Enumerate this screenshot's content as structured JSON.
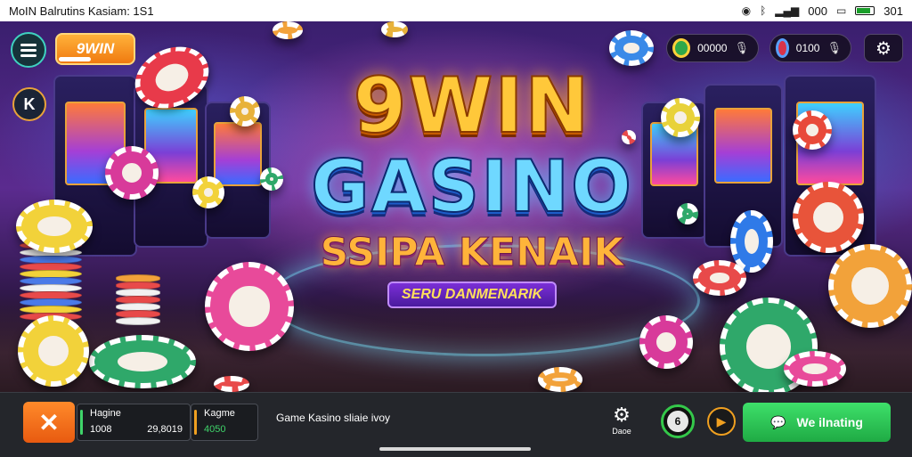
{
  "status_bar": {
    "left_text": "MoIN Balrutins Kasiam: 1S1",
    "icons": [
      "shield-icon",
      "bluetooth-icon",
      "signal-icon"
    ],
    "network_text": "000",
    "battery_text": "301",
    "battery_level": 0.9
  },
  "header": {
    "logo_text": "9WIN",
    "pills": [
      {
        "icon": "green-coin-icon",
        "value": "00000",
        "mic": "mic-icon"
      },
      {
        "icon": "red-chip-icon",
        "value": "0100",
        "mic": "mic-icon"
      }
    ],
    "menu_icon": "hamburger-menu-icon",
    "back_icon_text": "K",
    "settings_icon": "gear-icon"
  },
  "title": {
    "line1": "9WIN",
    "line2": "GASINO",
    "line3": "SSIPA KENAIK",
    "badge": "SERU DANMENARIK"
  },
  "bottom_bar": {
    "close_icon": "close-x-icon",
    "stat1": {
      "label": "Hagine",
      "value_a": "1008",
      "value_b": "29,8019"
    },
    "stat2": {
      "label": "Kagme",
      "value": "4050"
    },
    "info_text": "Game Kasino sliaie ivoy",
    "game_label": "Daoe",
    "round_green_label": "6",
    "play_icon": "play-icon",
    "cta_label": "We ilnating",
    "cta_icon": "chat-bubble-icon"
  },
  "colors": {
    "accent_orange": "#f07a10",
    "accent_green": "#1faa44",
    "title_gold": "#ffc83a",
    "title_blue": "#6fd8ff"
  }
}
